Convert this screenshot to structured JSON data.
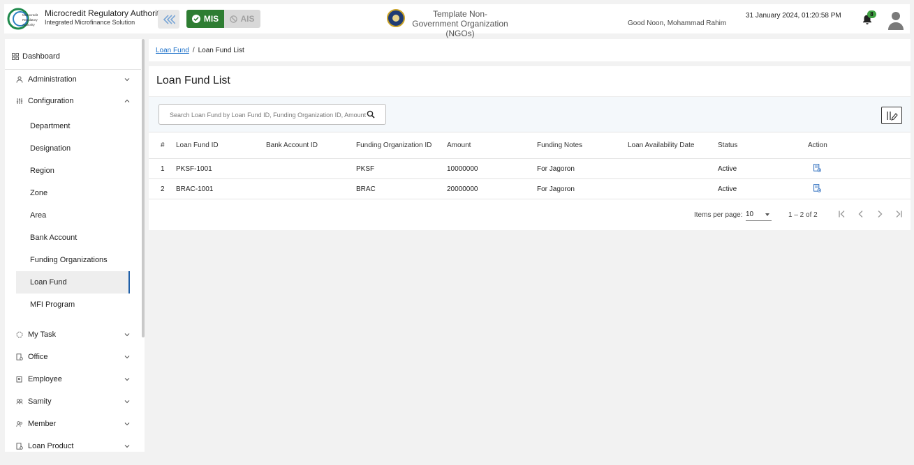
{
  "header": {
    "brand_title": "Microcredit Regulatory Authority",
    "brand_subtitle": "Integrated Microfinance Solution",
    "logo_text": "Microcredit Regulatory Authority",
    "mode_mis": "MIS",
    "mode_ais": "AIS",
    "org_name": "Template Non-Government Organization (NGOs)",
    "greeting": "Good Noon, Mohammad Rahim",
    "datetime": "31 January 2024, 01:20:58 PM",
    "notification_count": "8",
    "colors": {
      "mis_active": "#2e7d32",
      "badge": "#3fa142"
    }
  },
  "sidebar": {
    "dashboard": "Dashboard",
    "administration": "Administration",
    "configuration": "Configuration",
    "config_items": [
      "Department",
      "Designation",
      "Region",
      "Zone",
      "Area",
      "Bank Account",
      "Funding Organizations",
      "Loan Fund",
      "MFI Program"
    ],
    "active_item": "Loan Fund",
    "my_task": "My Task",
    "office": "Office",
    "employee": "Employee",
    "samity": "Samity",
    "member": "Member",
    "loan_product": "Loan Product"
  },
  "breadcrumb": {
    "parent": "Loan Fund",
    "separator": "/",
    "current": "Loan Fund List"
  },
  "panel": {
    "title": "Loan Fund List",
    "search_placeholder": "Search Loan Fund by Loan Fund ID, Funding Organization ID, Amount"
  },
  "table": {
    "columns": [
      "#",
      "Loan Fund ID",
      "Bank Account ID",
      "Funding Organization ID",
      "Amount",
      "Funding Notes",
      "Loan Availability Date",
      "Status",
      "Action"
    ],
    "rows": [
      {
        "num": "1",
        "loan_fund_id": "PKSF-1001",
        "bank_account_id": "",
        "funding_org_id": "PKSF",
        "amount": "10000000",
        "funding_notes": "For Jagoron",
        "availability_date": "",
        "status": "Active"
      },
      {
        "num": "2",
        "loan_fund_id": "BRAC-1001",
        "bank_account_id": "",
        "funding_org_id": "BRAC",
        "amount": "20000000",
        "funding_notes": "For Jagoron",
        "availability_date": "",
        "status": "Active"
      }
    ]
  },
  "pagination": {
    "items_per_page_label": "Items per page:",
    "items_per_page": "10",
    "range": "1 – 2 of 2"
  }
}
